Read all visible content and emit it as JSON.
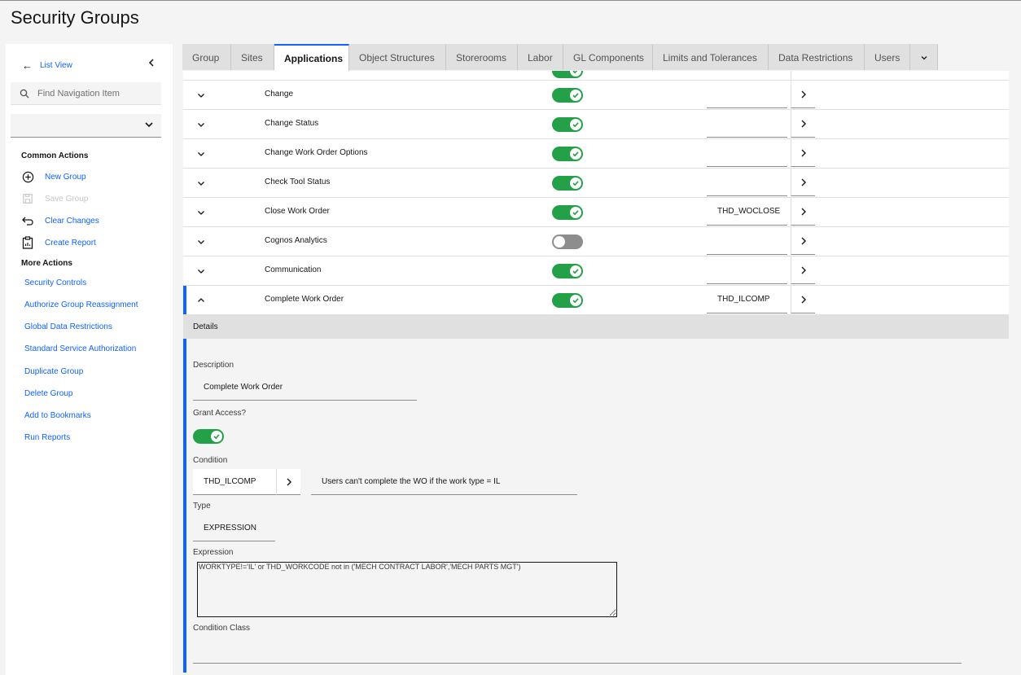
{
  "page": {
    "title": "Security Groups"
  },
  "sidebar": {
    "back_label": "List View",
    "search_placeholder": "Find Navigation Item",
    "select_value": "",
    "common_actions_title": "Common Actions",
    "common_actions": [
      {
        "label": "New Group",
        "icon": "add-circle-icon",
        "enabled": true
      },
      {
        "label": "Save Group",
        "icon": "save-icon",
        "enabled": false
      },
      {
        "label": "Clear Changes",
        "icon": "undo-icon",
        "enabled": true
      },
      {
        "label": "Create Report",
        "icon": "report-icon",
        "enabled": true
      }
    ],
    "more_actions_title": "More Actions",
    "more_actions": [
      "Security Controls",
      "Authorize Group Reassignment",
      "Global Data Restrictions",
      "Standard Service Authorization",
      "Duplicate Group",
      "Delete Group",
      "Add to Bookmarks",
      "Run Reports"
    ]
  },
  "tabs": [
    {
      "label": "Group",
      "active": false
    },
    {
      "label": "Sites",
      "active": false
    },
    {
      "label": "Applications",
      "active": true
    },
    {
      "label": "Object Structures",
      "active": false
    },
    {
      "label": "Storerooms",
      "active": false
    },
    {
      "label": "Labor",
      "active": false
    },
    {
      "label": "GL Components",
      "active": false
    },
    {
      "label": "Limits and Tolerances",
      "active": false
    },
    {
      "label": "Data Restrictions",
      "active": false
    },
    {
      "label": "Users",
      "active": false
    }
  ],
  "applications": [
    {
      "name": "Change",
      "granted": true,
      "condition": ""
    },
    {
      "name": "Change Status",
      "granted": true,
      "condition": ""
    },
    {
      "name": "Change Work Order Options",
      "granted": true,
      "condition": ""
    },
    {
      "name": "Check Tool Status",
      "granted": true,
      "condition": ""
    },
    {
      "name": "Close Work Order",
      "granted": true,
      "condition": "THD_WOCLOSE"
    },
    {
      "name": "Cognos Analytics",
      "granted": false,
      "condition": ""
    },
    {
      "name": "Communication",
      "granted": true,
      "condition": ""
    },
    {
      "name": "Complete Work Order",
      "granted": true,
      "condition": "THD_ILCOMP",
      "expanded": true
    }
  ],
  "details": {
    "header": "Details",
    "description_label": "Description",
    "description_value": "Complete Work Order",
    "grant_label": "Grant Access?",
    "granted": true,
    "condition_label": "Condition",
    "condition_value": "THD_ILCOMP",
    "condition_description": "Users can't complete the WO if the work type = IL",
    "type_label": "Type",
    "type_value": "EXPRESSION",
    "expression_label": "Expression",
    "expression_value": "WORKTYPE!='IL' or THD_WORKCODE not in ('MECH CONTRACT LABOR','MECH PARTS MGT')",
    "condition_class_label": "Condition Class",
    "condition_class_value": ""
  },
  "colors": {
    "accent": "#0f62fe",
    "toggle_on": "#24a148",
    "toggle_off": "#8d8d8d"
  }
}
